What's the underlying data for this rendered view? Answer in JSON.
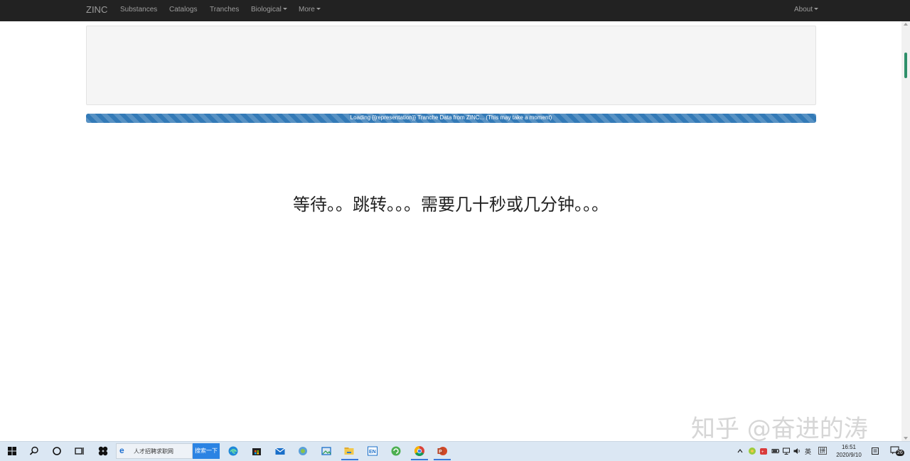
{
  "navbar": {
    "brand": "ZINC",
    "items": [
      "Substances",
      "Catalogs",
      "Tranches",
      "Biological",
      "More"
    ],
    "right_item": "About"
  },
  "progress": {
    "text": "Loading {{representation}} Tranche Data from ZINC... (This may take a moment)",
    "percent": 100
  },
  "message": "等待。。跳转。。。需要几十秒或几分钟。。。",
  "watermark": "知乎 @奋进的涛",
  "taskbar": {
    "search_text": "人才招聘求职网",
    "search_button": "搜索一下",
    "ime_lang": "英",
    "ime_mode": "拼",
    "time": "16:51",
    "date": "2020/9/10",
    "notification_count": "26"
  },
  "colors": {
    "navbar_bg": "#222222",
    "progress_bar": "#337ab7",
    "taskbar_bg": "#dbe7f3"
  }
}
